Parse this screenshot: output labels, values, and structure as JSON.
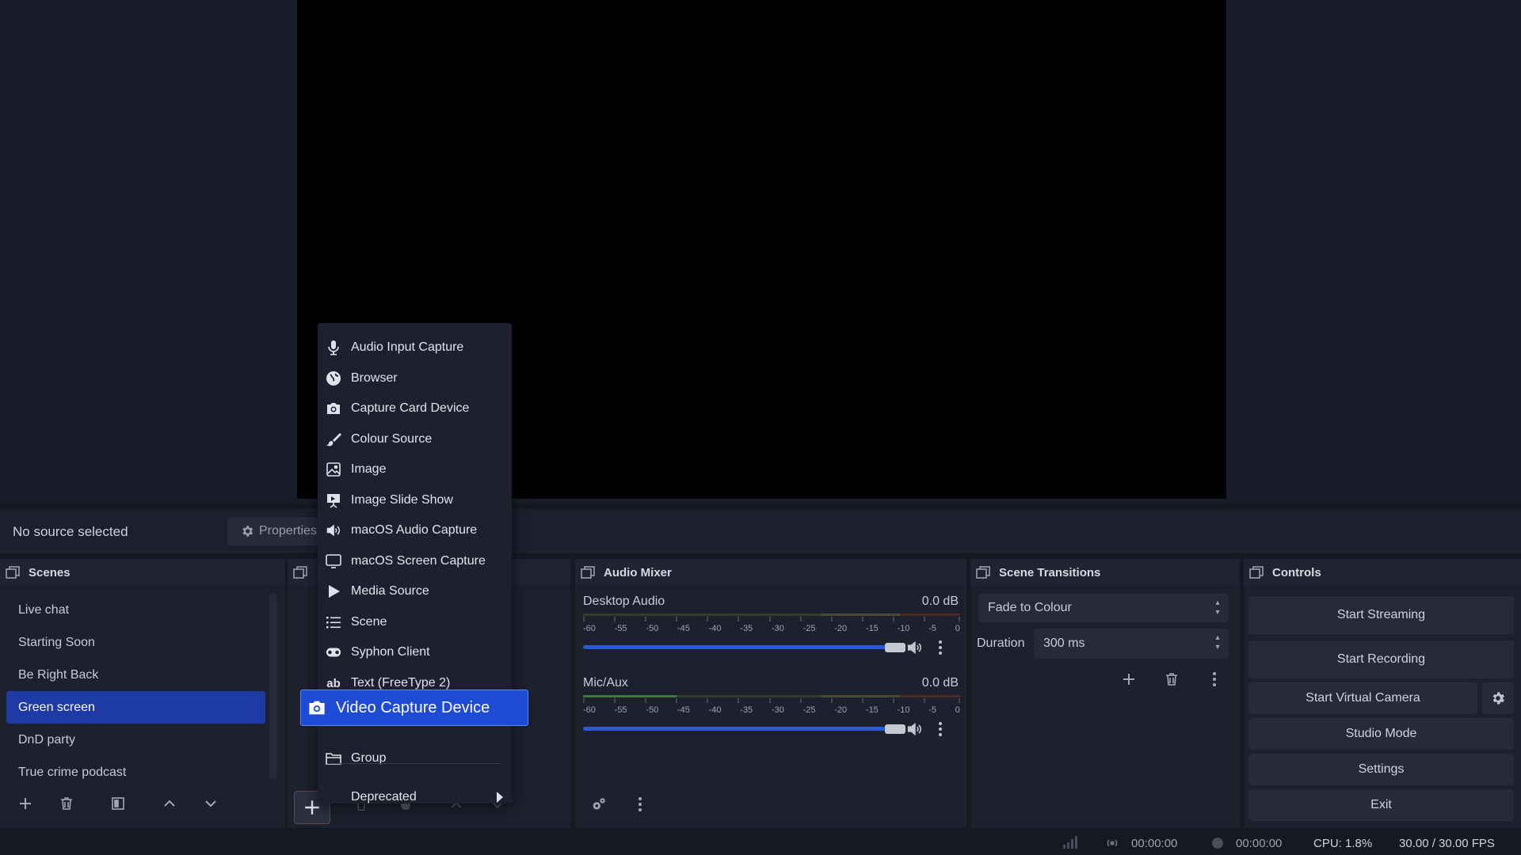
{
  "source_bar": {
    "no_source": "No source selected",
    "properties_label": "Properties"
  },
  "scenes": {
    "title": "Scenes",
    "items": [
      {
        "label": "Live chat"
      },
      {
        "label": "Starting Soon"
      },
      {
        "label": "Be Right Back"
      },
      {
        "label": "Green screen",
        "active": true
      },
      {
        "label": "DnD party"
      },
      {
        "label": "True crime podcast"
      }
    ]
  },
  "context_menu": {
    "items": [
      {
        "label": "Audio Input Capture",
        "icon": "microphone-icon"
      },
      {
        "label": "Browser",
        "icon": "globe-icon"
      },
      {
        "label": "Capture Card Device",
        "icon": "camera-icon"
      },
      {
        "label": "Colour Source",
        "icon": "brush-icon"
      },
      {
        "label": "Image",
        "icon": "image-icon"
      },
      {
        "label": "Image Slide Show",
        "icon": "slideshow-icon"
      },
      {
        "label": "macOS Audio Capture",
        "icon": "speaker-icon"
      },
      {
        "label": "macOS Screen Capture",
        "icon": "monitor-icon"
      },
      {
        "label": "Media Source",
        "icon": "play-icon"
      },
      {
        "label": "Scene",
        "icon": "list-icon"
      },
      {
        "label": "Syphon Client",
        "icon": "gamepad-icon"
      },
      {
        "label": "Text (FreeType 2)",
        "icon": "text-icon"
      }
    ],
    "highlighted": {
      "label": "Video Capture Device",
      "icon": "camera-icon"
    },
    "group": {
      "label": "Group",
      "icon": "folder-icon"
    },
    "deprecated": {
      "label": "Deprecated"
    }
  },
  "mixer": {
    "title": "Audio Mixer",
    "ticks": [
      "-60",
      "-55",
      "-50",
      "-45",
      "-40",
      "-35",
      "-30",
      "-25",
      "-20",
      "-15",
      "-10",
      "-5",
      "0"
    ],
    "channels": [
      {
        "name": "Desktop Audio",
        "db": "0.0 dB",
        "volume_level": 1.0
      },
      {
        "name": "Mic/Aux",
        "db": "0.0 dB",
        "volume_level": 1.0
      }
    ]
  },
  "transitions": {
    "title": "Scene Transitions",
    "selected": "Fade to Colour",
    "duration_label": "Duration",
    "duration_value": "300 ms"
  },
  "controls": {
    "title": "Controls",
    "start_streaming": "Start Streaming",
    "start_recording": "Start Recording",
    "start_virtual_camera": "Start Virtual Camera",
    "studio_mode": "Studio Mode",
    "settings": "Settings",
    "exit": "Exit"
  },
  "status": {
    "stream_time": "00:00:00",
    "record_time": "00:00:00",
    "cpu": "CPU: 1.8%",
    "fps": "30.00 / 30.00 FPS"
  },
  "colors": {
    "accent": "#1e4bd4",
    "selected_scene": "#1e3ba5",
    "background": "#161822",
    "panel": "#1d202d"
  }
}
